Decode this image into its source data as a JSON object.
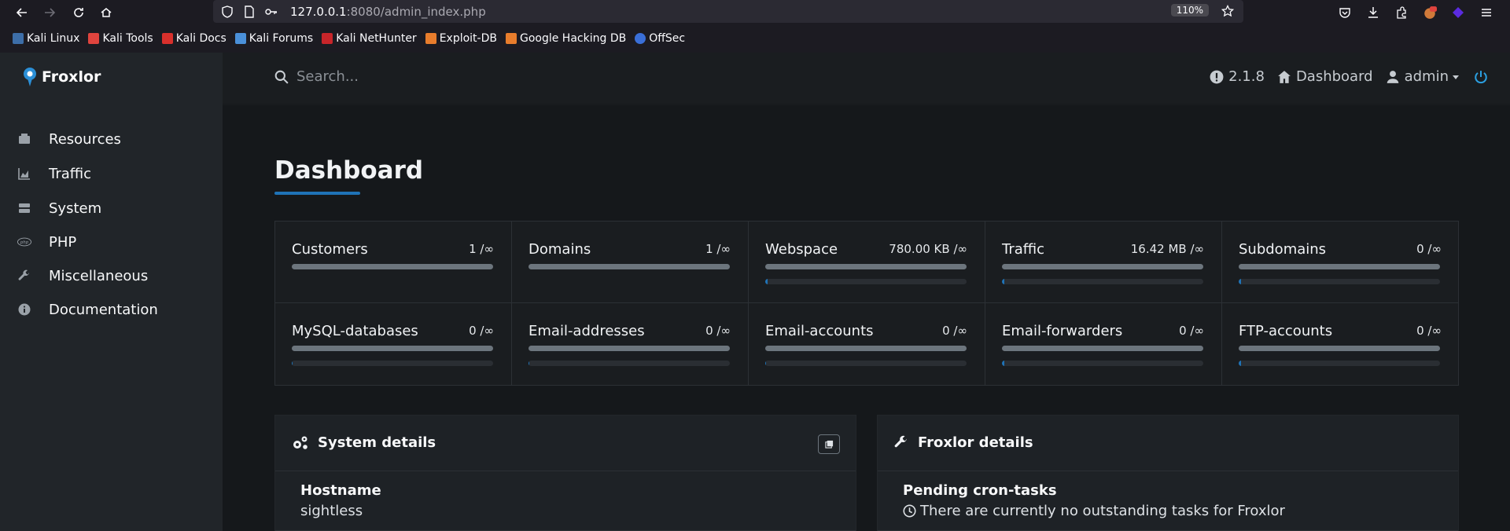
{
  "browser": {
    "url_host": "127.0.0.1",
    "url_rest": ":8080/admin_index.php",
    "zoom": "110%",
    "bookmarks": [
      {
        "label": "Kali Linux",
        "color": "#5b9bd5"
      },
      {
        "label": "Kali Tools",
        "color": "#e0443e"
      },
      {
        "label": "Kali Docs",
        "color": "#d9302c"
      },
      {
        "label": "Kali Forums",
        "color": "#4a90d9"
      },
      {
        "label": "Kali NetHunter",
        "color": "#c8252a"
      },
      {
        "label": "Exploit-DB",
        "color": "#e87d2c"
      },
      {
        "label": "Google Hacking DB",
        "color": "#e87d2c"
      },
      {
        "label": "OffSec",
        "color": "#3a6fd8"
      }
    ]
  },
  "app": {
    "brand": "Froxlor",
    "sidebar": [
      {
        "label": "Resources",
        "icon": "cubes-icon"
      },
      {
        "label": "Traffic",
        "icon": "area-chart-icon"
      },
      {
        "label": "System",
        "icon": "server-icon"
      },
      {
        "label": "PHP",
        "icon": "php-icon"
      },
      {
        "label": "Miscellaneous",
        "icon": "wrench-icon"
      },
      {
        "label": "Documentation",
        "icon": "info-circle-icon"
      }
    ],
    "search_placeholder": "Search...",
    "version": "2.1.8",
    "dashboard_link": "Dashboard",
    "user": "admin"
  },
  "page": {
    "title": "Dashboard",
    "stats": [
      {
        "label": "Customers",
        "value": "1 /∞",
        "usage": 0
      },
      {
        "label": "Domains",
        "value": "1 /∞",
        "usage": 0
      },
      {
        "label": "Webspace",
        "value": "780.00 KB /∞",
        "usage": 0.01
      },
      {
        "label": "Traffic",
        "value": "16.42 MB /∞",
        "usage": 0.01
      },
      {
        "label": "Subdomains",
        "value": "0 /∞",
        "usage": 0.01
      },
      {
        "label": "MySQL-databases",
        "value": "0 /∞",
        "usage": 0.005
      },
      {
        "label": "Email-addresses",
        "value": "0 /∞",
        "usage": 0.005
      },
      {
        "label": "Email-accounts",
        "value": "0 /∞",
        "usage": 0.005
      },
      {
        "label": "Email-forwarders",
        "value": "0 /∞",
        "usage": 0.01
      },
      {
        "label": "FTP-accounts",
        "value": "0 /∞",
        "usage": 0.01
      }
    ],
    "system_card": {
      "title": "System details",
      "row_label": "Hostname",
      "row_value": "sightless"
    },
    "froxlor_card": {
      "title": "Froxlor details",
      "row_label": "Pending cron-tasks",
      "row_value": "There are currently no outstanding tasks for Froxlor"
    }
  }
}
